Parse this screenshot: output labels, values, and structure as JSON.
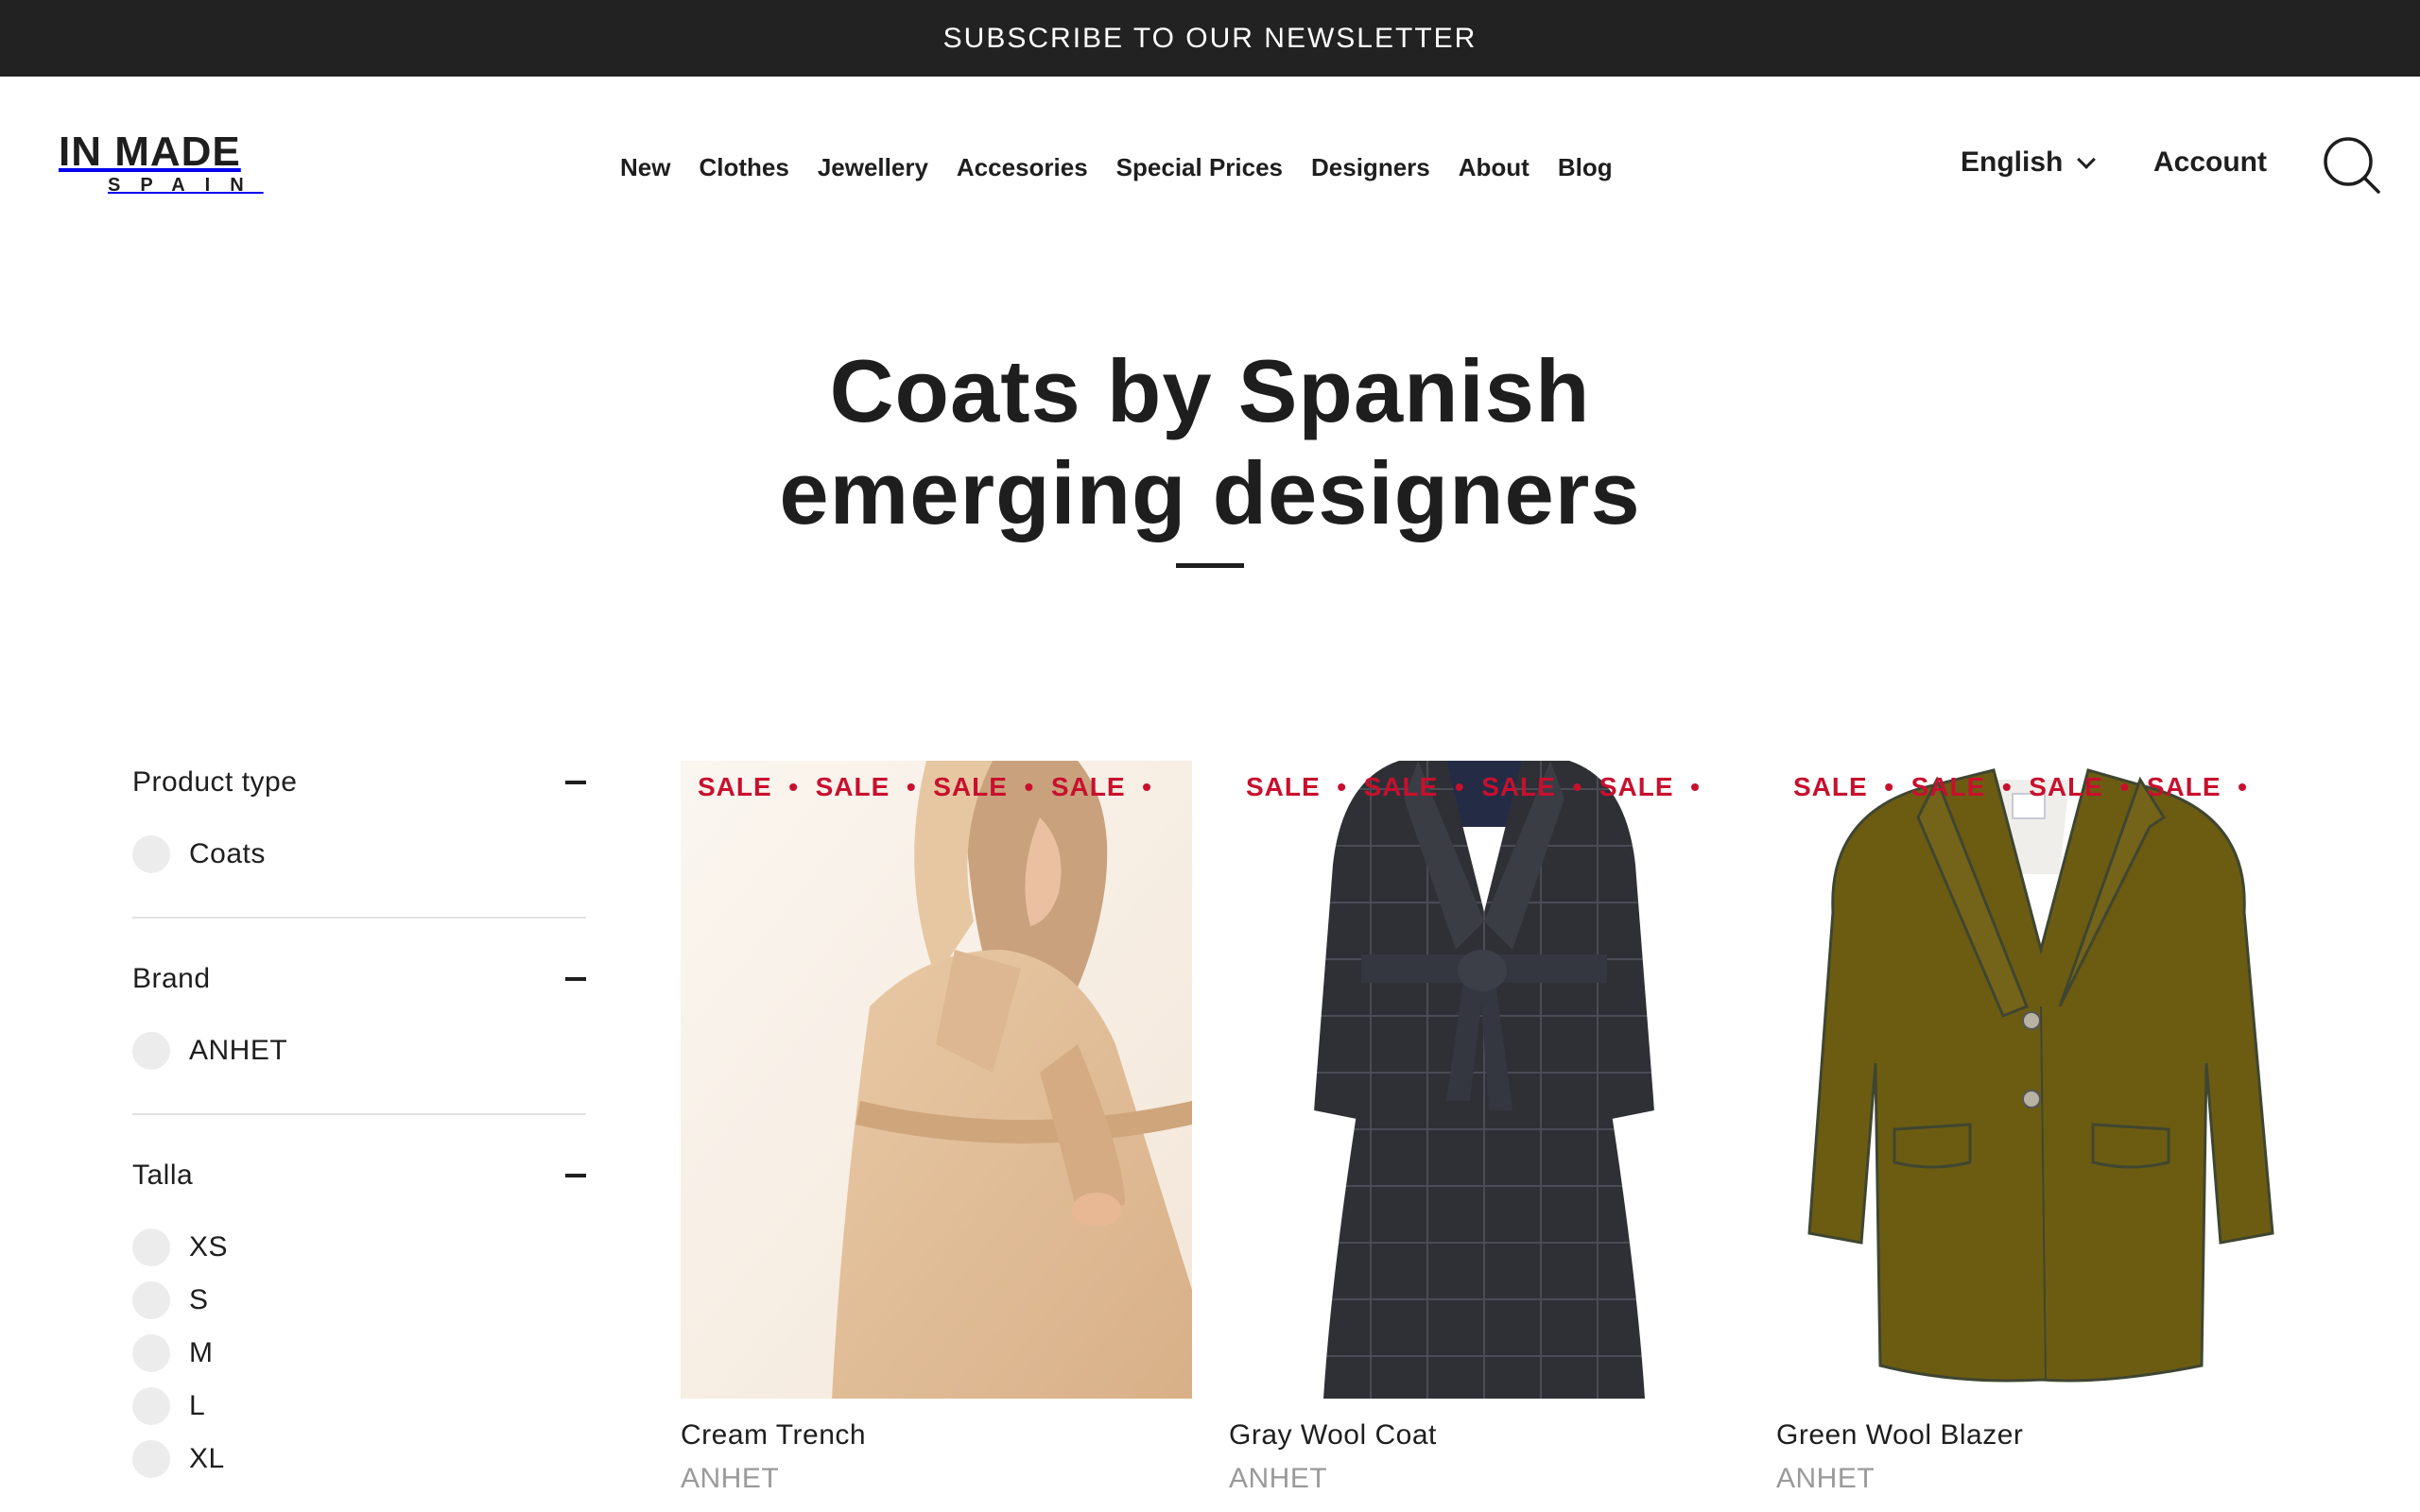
{
  "topbar": {
    "label": "SUBSCRIBE TO OUR NEWSLETTER"
  },
  "logo": {
    "main": "IN MADE",
    "sub": "SPAIN"
  },
  "nav": {
    "items": [
      "New",
      "Clothes",
      "Jewellery",
      "Accesories",
      "Special Prices",
      "Designers",
      "About",
      "Blog"
    ]
  },
  "header": {
    "language": "English",
    "account": "Account",
    "search_icon": "search-icon"
  },
  "page": {
    "title_line1": "Coats by Spanish",
    "title_line2": "emerging designers"
  },
  "filters": [
    {
      "title": "Product type",
      "options": [
        "Coats"
      ]
    },
    {
      "title": "Brand",
      "options": [
        "ANHET"
      ]
    },
    {
      "title": "Talla",
      "options": [
        "XS",
        "S",
        "M",
        "L",
        "XL"
      ]
    }
  ],
  "sale_label": "SALE",
  "products": [
    {
      "name": "Cream Trench",
      "brand": "ANHET"
    },
    {
      "name": "Gray Wool Coat",
      "brand": "ANHET"
    },
    {
      "name": "Green Wool Blazer",
      "brand": "ANHET"
    }
  ],
  "colors": {
    "topbar": "#222222",
    "text": "#1e1e1e",
    "sale": "#c8102e",
    "brand_gray": "#9a9a9a",
    "radio": "#ececec"
  }
}
